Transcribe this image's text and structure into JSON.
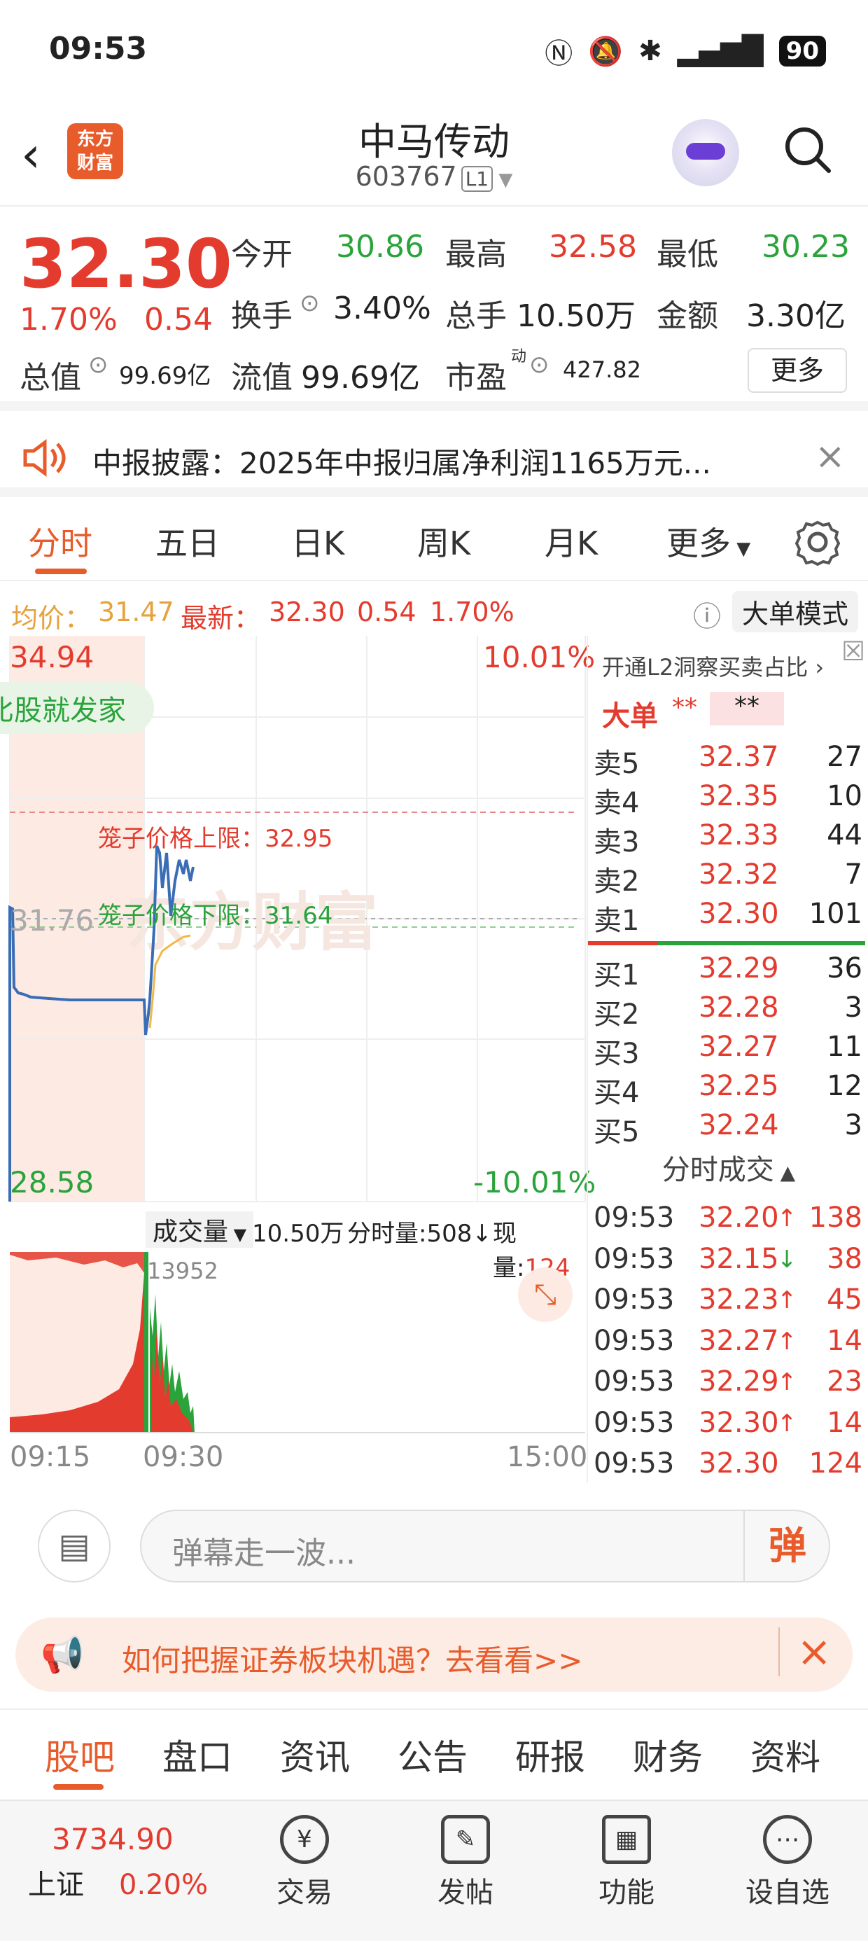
{
  "status": {
    "time": "09:53",
    "battery": "90",
    "icons": [
      "nfc-icon",
      "mute-icon",
      "bluetooth-icon",
      "5g-signal-icon"
    ]
  },
  "header": {
    "name": "中马传动",
    "code": "603767",
    "level": "L1",
    "logo_line1": "东方",
    "logo_line2": "财富"
  },
  "quote": {
    "price": "32.30",
    "change_pct": "1.70%",
    "change": "0.54",
    "open_label": "今开",
    "open": "30.86",
    "high_label": "最高",
    "high": "32.58",
    "low_label": "最低",
    "low": "30.23",
    "turnover_label": "换手",
    "turnover": "3.40%",
    "volume_label": "总手",
    "volume": "10.50万",
    "amount_label": "金额",
    "amount": "3.30亿",
    "mcap_label": "总值",
    "mcap": "99.69亿",
    "float_label": "流值",
    "float": "99.69亿",
    "pe_label": "市盈",
    "pe_sup": "动",
    "pe": "427.82",
    "more": "更多"
  },
  "notice": {
    "text": "中报披露：2025年中报归属净利润1165万元..."
  },
  "tabs": [
    "分时",
    "五日",
    "日K",
    "周K",
    "月K",
    "更多"
  ],
  "info": {
    "avg_label": "均价：",
    "avg": "31.47",
    "last_label": "最新：",
    "last": "32.30",
    "chg": "0.54",
    "pct": "1.70%",
    "mode": "大单模式"
  },
  "chart": {
    "y_top": "34.94",
    "y_mid": "31.76",
    "y_bot": "28.58",
    "pct_top": "10.01%",
    "pct_bot": "-10.01%",
    "badge": "比股就发家",
    "cage_up": "笼子价格上限：32.95",
    "cage_down": "笼子价格下限：31.64",
    "watermark": "东方财富"
  },
  "volume": {
    "label": "成交量",
    "total": "10.50万",
    "minute": "分时量:508",
    "now_label": "现量:",
    "now": "124",
    "peak": "13952",
    "t_start": "09:15",
    "t_mid": "09:30",
    "t_end": "15:00"
  },
  "book": {
    "l2_link": "开通L2洞察买卖占比",
    "big_order": "大单",
    "mask1": "**",
    "mask2": "**",
    "asks": [
      {
        "label": "卖5",
        "price": "32.37",
        "vol": "27"
      },
      {
        "label": "卖4",
        "price": "32.35",
        "vol": "10"
      },
      {
        "label": "卖3",
        "price": "32.33",
        "vol": "44"
      },
      {
        "label": "卖2",
        "price": "32.32",
        "vol": "7"
      },
      {
        "label": "卖1",
        "price": "32.30",
        "vol": "101"
      }
    ],
    "bids": [
      {
        "label": "买1",
        "price": "32.29",
        "vol": "36"
      },
      {
        "label": "买2",
        "price": "32.28",
        "vol": "3"
      },
      {
        "label": "买3",
        "price": "32.27",
        "vol": "11"
      },
      {
        "label": "买4",
        "price": "32.25",
        "vol": "12"
      },
      {
        "label": "买5",
        "price": "32.24",
        "vol": "3"
      }
    ],
    "trades_title": "分时成交",
    "trades": [
      {
        "time": "09:53",
        "price": "32.20",
        "dir": "↑",
        "vol": "138"
      },
      {
        "time": "09:53",
        "price": "32.15",
        "dir": "↓",
        "vol": "38"
      },
      {
        "time": "09:53",
        "price": "32.23",
        "dir": "↑",
        "vol": "45"
      },
      {
        "time": "09:53",
        "price": "32.27",
        "dir": "↑",
        "vol": "14"
      },
      {
        "time": "09:53",
        "price": "32.29",
        "dir": "↑",
        "vol": "23"
      },
      {
        "time": "09:53",
        "price": "32.30",
        "dir": "↑",
        "vol": "14"
      },
      {
        "time": "09:53",
        "price": "32.30",
        "dir": "",
        "vol": "124"
      }
    ]
  },
  "comment": {
    "placeholder": "弹幕走一波...",
    "danmu": "弹"
  },
  "ad": {
    "text": "如何把握证券板块机遇？去看看>>"
  },
  "bottom_tabs": [
    "股吧",
    "盘口",
    "资讯",
    "公告",
    "研报",
    "财务",
    "资料"
  ],
  "navbar": {
    "index_value": "3734.90",
    "index_name": "上证",
    "index_pct": "0.20%",
    "items": [
      "交易",
      "发帖",
      "功能",
      "设自选"
    ]
  },
  "colors": {
    "up": "#e33b2e",
    "down": "#2aa33b",
    "accent": "#e85b2a",
    "line": "#3a6db5"
  }
}
